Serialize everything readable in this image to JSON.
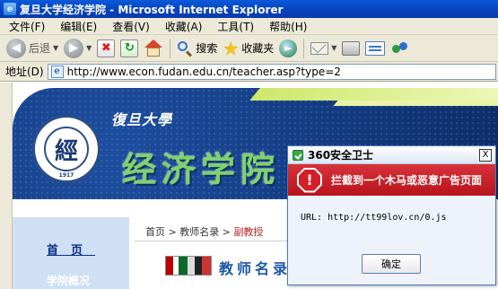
{
  "window": {
    "title": "复旦大学经济学院 - Microsoft Internet Explorer"
  },
  "menu": {
    "items": [
      "文件(F)",
      "编辑(E)",
      "查看(V)",
      "收藏(A)",
      "工具(T)",
      "帮助(H)"
    ]
  },
  "toolbar": {
    "back_label": "后退",
    "search_label": "搜索",
    "favorites_label": "收藏夹"
  },
  "address": {
    "label": "地址(D)",
    "url": "http://www.econ.fudan.edu.cn/teacher.asp?type=2"
  },
  "page": {
    "university_name": "復旦大學",
    "school_name": "经济学院",
    "seal_char": "經",
    "seal_year": "1917",
    "nav": {
      "home": "首页",
      "overview": "学院概况"
    },
    "breadcrumb": {
      "home": "首页",
      "sep": " > ",
      "list": "教师名录",
      "current": "副教授"
    },
    "section_title": "教师名录"
  },
  "popup": {
    "title": "360安全卫士",
    "close_label": "X",
    "alert_text": "拦截到一个木马或恶意广告页面",
    "url_line": "URL: http://tt99lov.cn/0.js",
    "ok_label": "确定"
  },
  "colors": {
    "titlebar": "#0846c4",
    "banner": "#123a80",
    "school_text": "#7ed36b",
    "alert_red": "#c8202a"
  }
}
